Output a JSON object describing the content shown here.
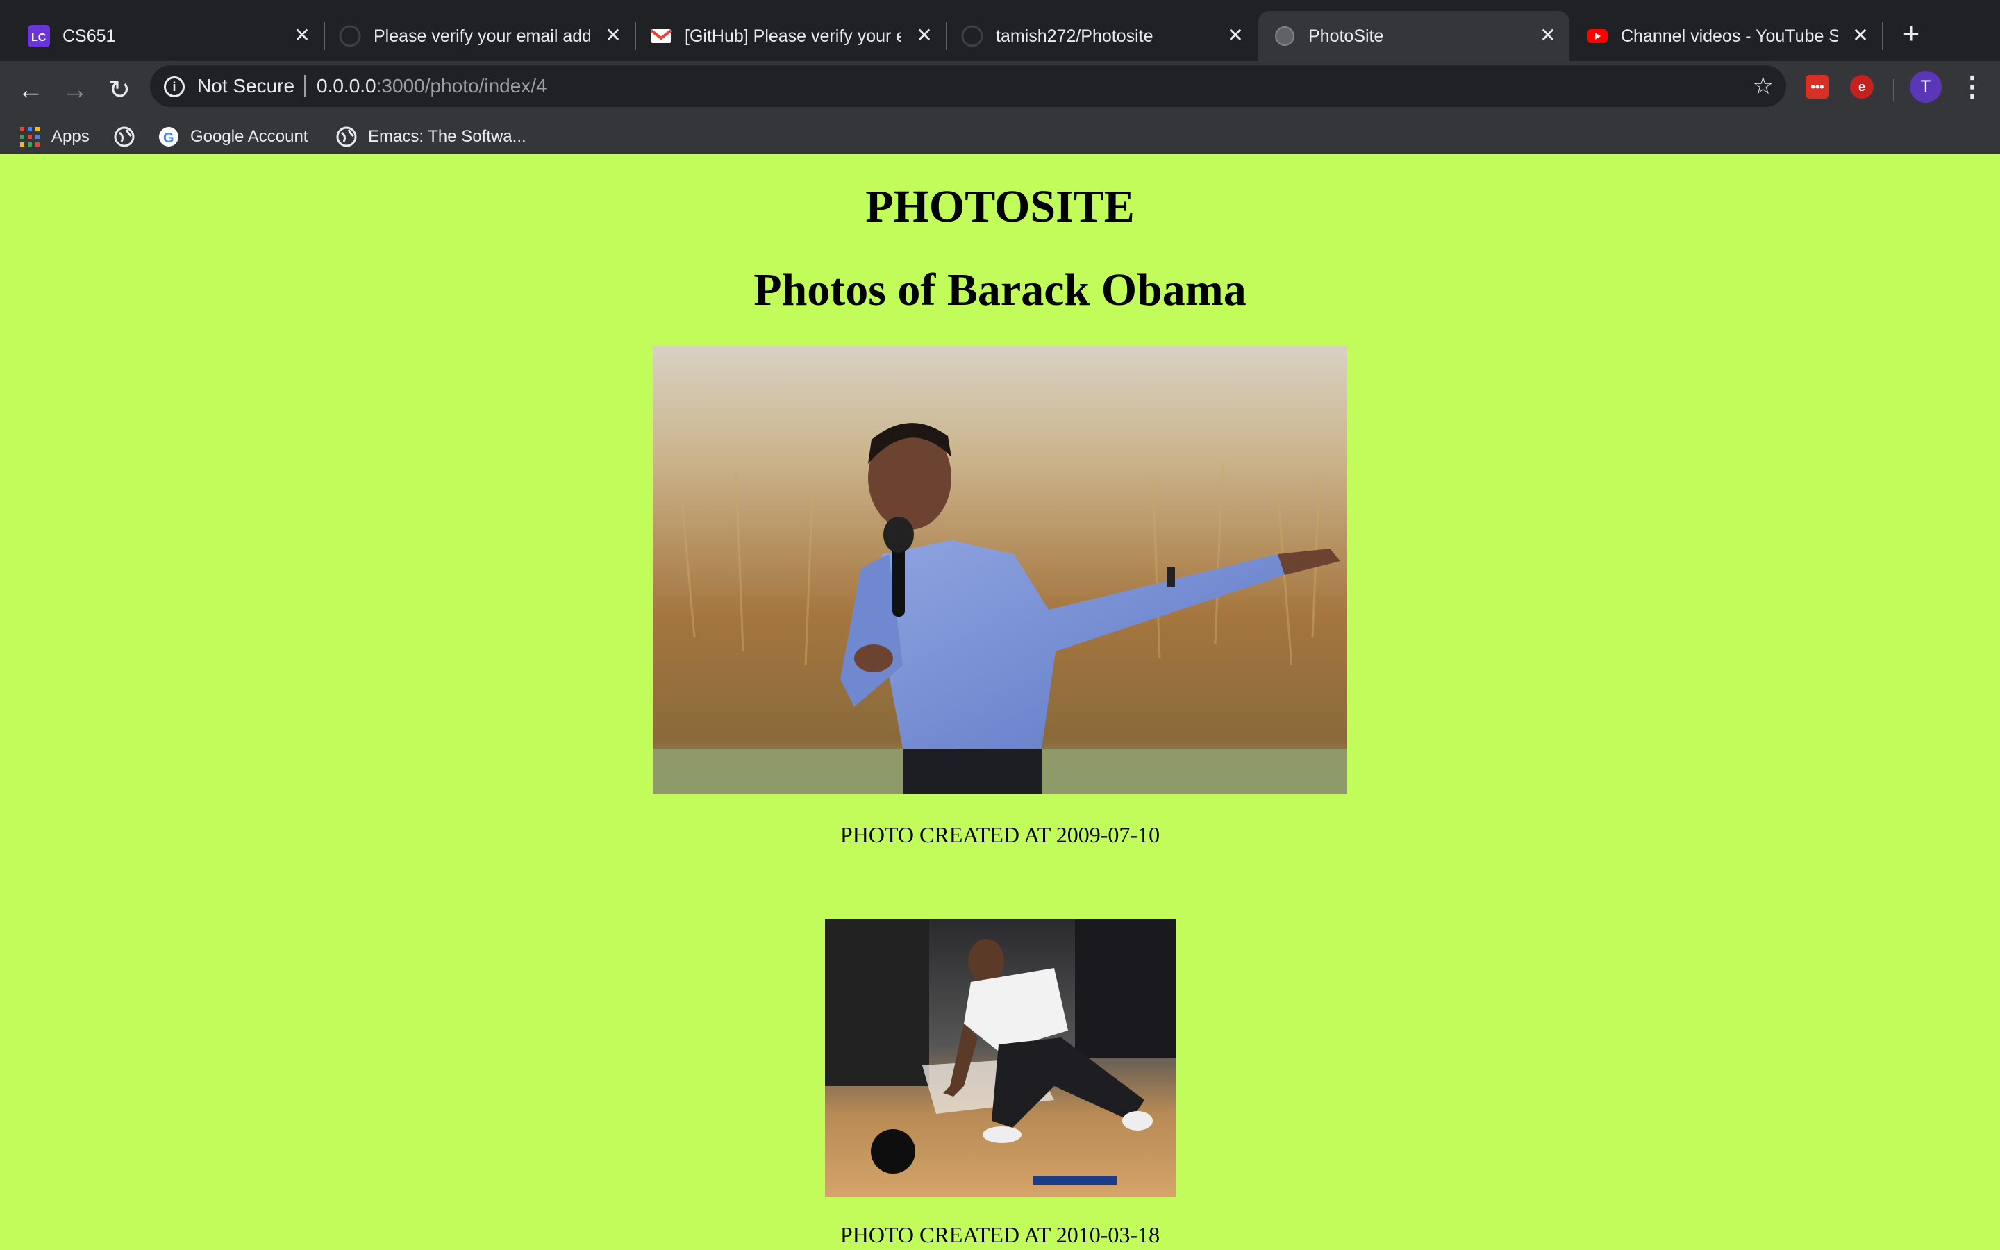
{
  "browser": {
    "tabs": [
      {
        "title": "CS651",
        "favicon": "lc-app-icon",
        "active": false
      },
      {
        "title": "Please verify your email address",
        "favicon": "github-icon",
        "active": false
      },
      {
        "title": "[GitHub] Please verify your email",
        "favicon": "gmail-icon",
        "active": false
      },
      {
        "title": "tamish272/Photosite",
        "favicon": "github-icon",
        "active": false
      },
      {
        "title": "PhotoSite",
        "favicon": "globe-icon",
        "active": true
      },
      {
        "title": "Channel videos - YouTube Studio",
        "favicon": "youtube-icon",
        "active": false
      }
    ],
    "new_tab": "+",
    "address": {
      "security_label": "Not Secure",
      "host": "0.0.0.0",
      "path": ":3000/photo/index/4"
    },
    "profile_initial": "T",
    "bookmarks": [
      {
        "label": "Apps",
        "icon": "apps-grid-icon"
      },
      {
        "label": "",
        "icon": "globe-icon"
      },
      {
        "label": "Google Account",
        "icon": "google-icon"
      },
      {
        "label": "Emacs: The Softwa...",
        "icon": "globe-icon"
      }
    ]
  },
  "page": {
    "site_title": "PHOTOSITE",
    "heading": "Photos of Barack Obama",
    "background": "#c2fc5b",
    "photos": [
      {
        "caption": "PHOTO CREATED AT 2009-07-10"
      },
      {
        "caption": "PHOTO CREATED AT 2010-03-18"
      }
    ]
  }
}
